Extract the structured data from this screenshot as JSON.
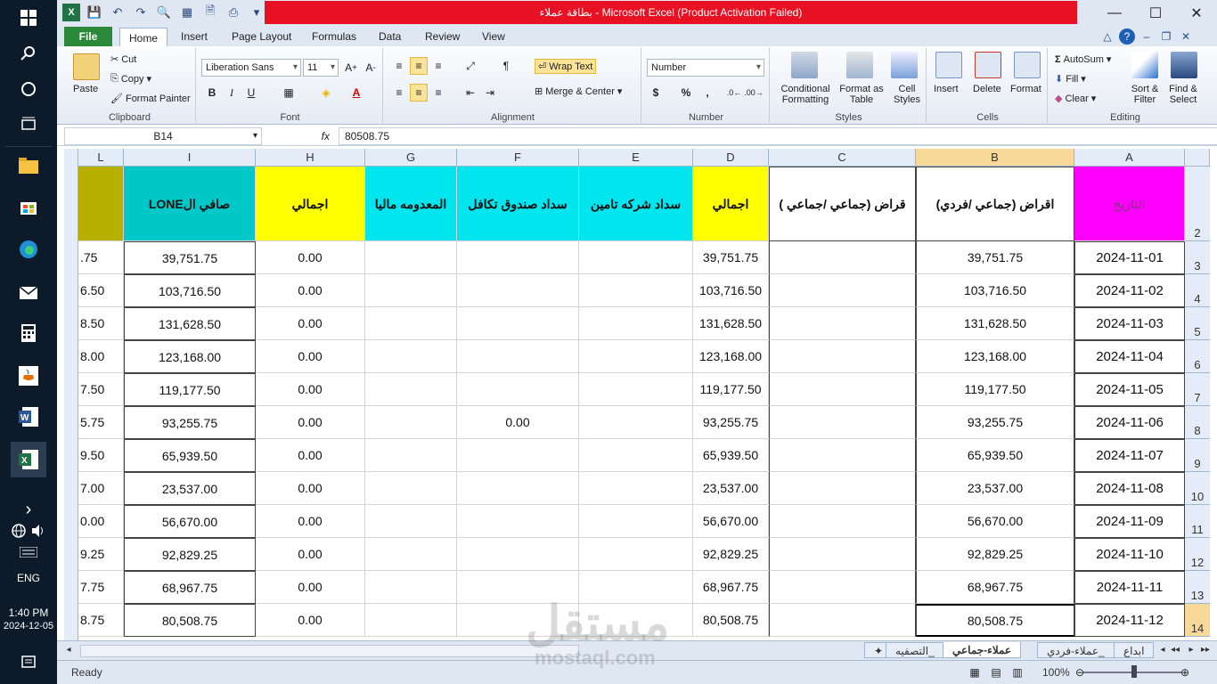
{
  "taskbar": {
    "time": "1:40 PM",
    "date": "2024-12-05",
    "lang": "ENG"
  },
  "window": {
    "title": "بطاقة عملاء  -  Microsoft Excel (Product Activation Failed)"
  },
  "menu": {
    "tabs": [
      "File",
      "Home",
      "Insert",
      "Page Layout",
      "Formulas",
      "Data",
      "Review",
      "View"
    ],
    "active": "Home"
  },
  "ribbon": {
    "clipboard": {
      "label": "Clipboard",
      "paste": "Paste",
      "cut": "Cut",
      "copy": "Copy",
      "format_painter": "Format Painter"
    },
    "font": {
      "label": "Font",
      "name": "Liberation Sans",
      "size": "11",
      "bold": "B",
      "italic": "I",
      "underline": "U"
    },
    "alignment": {
      "label": "Alignment",
      "wrap_text": "Wrap Text",
      "merge_center": "Merge & Center"
    },
    "number": {
      "label": "Number",
      "format": "Number",
      "currency": "$",
      "percent": "%",
      "comma": ","
    },
    "styles": {
      "label": "Styles",
      "conditional": "Conditional Formatting",
      "format_table": "Format as Table",
      "cell_styles": "Cell Styles"
    },
    "cells": {
      "label": "Cells",
      "insert": "Insert",
      "delete": "Delete",
      "format": "Format"
    },
    "editing": {
      "label": "Editing",
      "autosum": "AutoSum",
      "fill": "Fill",
      "clear": "Clear",
      "sort_filter": "Sort & Filter",
      "find_select": "Find & Select"
    }
  },
  "formula_bar": {
    "name_box": "B14",
    "fx": "fx",
    "value": "80508.75"
  },
  "columns": [
    "L",
    "I",
    "H",
    "G",
    "F",
    "E",
    "D",
    "C",
    "B",
    "A"
  ],
  "headers": {
    "L": "",
    "I": "صافي الLONE",
    "H": "اجمالي",
    "G": "المعدومه ماليا",
    "F": "سداد صندوق تكافل",
    "E": "سداد شركه تامين",
    "D": "اجمالي",
    "C": "قراض (جماعي /جماعي )",
    "B": "اقراض (جماعي /فردي)",
    "A": "التاريخ"
  },
  "header_row_number": "2",
  "rows": [
    {
      "num": "3",
      "L": ".75",
      "I": "39,751.75",
      "H": "0.00",
      "F": "",
      "D": "39,751.75",
      "B": "39,751.75",
      "A": "2024-11-01"
    },
    {
      "num": "4",
      "L": "6.50",
      "I": "103,716.50",
      "H": "0.00",
      "F": "",
      "D": "103,716.50",
      "B": "103,716.50",
      "A": "2024-11-02"
    },
    {
      "num": "5",
      "L": "8.50",
      "I": "131,628.50",
      "H": "0.00",
      "F": "",
      "D": "131,628.50",
      "B": "131,628.50",
      "A": "2024-11-03"
    },
    {
      "num": "6",
      "L": "8.00",
      "I": "123,168.00",
      "H": "0.00",
      "F": "",
      "D": "123,168.00",
      "B": "123,168.00",
      "A": "2024-11-04"
    },
    {
      "num": "7",
      "L": "7.50",
      "I": "119,177.50",
      "H": "0.00",
      "F": "",
      "D": "119,177.50",
      "B": "119,177.50",
      "A": "2024-11-05"
    },
    {
      "num": "8",
      "L": "5.75",
      "I": "93,255.75",
      "H": "0.00",
      "F": "0.00",
      "D": "93,255.75",
      "B": "93,255.75",
      "A": "2024-11-06"
    },
    {
      "num": "9",
      "L": "9.50",
      "I": "65,939.50",
      "H": "0.00",
      "F": "",
      "D": "65,939.50",
      "B": "65,939.50",
      "A": "2024-11-07"
    },
    {
      "num": "10",
      "L": "7.00",
      "I": "23,537.00",
      "H": "0.00",
      "F": "",
      "D": "23,537.00",
      "B": "23,537.00",
      "A": "2024-11-08"
    },
    {
      "num": "11",
      "L": "0.00",
      "I": "56,670.00",
      "H": "0.00",
      "F": "",
      "D": "56,670.00",
      "B": "56,670.00",
      "A": "2024-11-09"
    },
    {
      "num": "12",
      "L": "9.25",
      "I": "92,829.25",
      "H": "0.00",
      "F": "",
      "D": "92,829.25",
      "B": "92,829.25",
      "A": "2024-11-10"
    },
    {
      "num": "13",
      "L": "7.75",
      "I": "68,967.75",
      "H": "0.00",
      "F": "",
      "D": "68,967.75",
      "B": "68,967.75",
      "A": "2024-11-11"
    },
    {
      "num": "14",
      "L": "8.75",
      "I": "80,508.75",
      "H": "0.00",
      "F": "",
      "D": "80,508.75",
      "B": "80,508.75",
      "A": "2024-11-12"
    }
  ],
  "sheets": [
    "ابداع",
    "عملاء-فردي_",
    "عملاء-جماعي",
    "التصفيه_"
  ],
  "active_sheet": "عملاء-جماعي",
  "status": {
    "ready": "Ready",
    "zoom": "100%"
  },
  "watermark": {
    "main": "مستقل",
    "sub": "mostaql.com"
  },
  "colors": {
    "header_yellow": "#ffff00",
    "header_cyan": "#00e5ee",
    "header_teal": "#00c8c8",
    "header_magenta": "#ff00ff",
    "header_olive": "#b8b000",
    "title_red": "#e81123"
  }
}
